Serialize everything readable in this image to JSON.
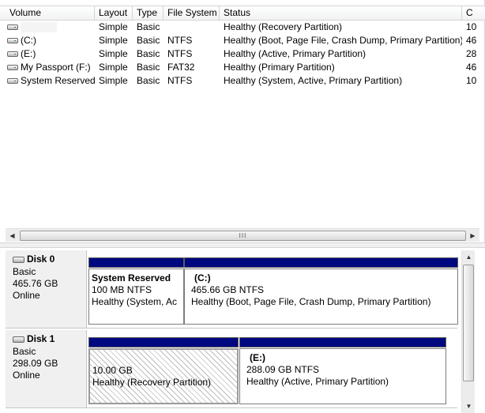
{
  "volume_list": {
    "columns": [
      {
        "key": "volume",
        "label": "Volume"
      },
      {
        "key": "layout",
        "label": "Layout"
      },
      {
        "key": "type",
        "label": "Type"
      },
      {
        "key": "fs",
        "label": "File System"
      },
      {
        "key": "status",
        "label": "Status"
      },
      {
        "key": "capacity",
        "label": "C"
      }
    ],
    "rows": [
      {
        "volume": "",
        "layout": "Simple",
        "type": "Basic",
        "fs": "",
        "status": "Healthy (Recovery Partition)",
        "capacity": "10"
      },
      {
        "volume": "(C:)",
        "layout": "Simple",
        "type": "Basic",
        "fs": "NTFS",
        "status": "Healthy (Boot, Page File, Crash Dump, Primary Partition)",
        "capacity": "46"
      },
      {
        "volume": "(E:)",
        "layout": "Simple",
        "type": "Basic",
        "fs": "NTFS",
        "status": "Healthy (Active, Primary Partition)",
        "capacity": "28"
      },
      {
        "volume": "My Passport (F:)",
        "layout": "Simple",
        "type": "Basic",
        "fs": "FAT32",
        "status": "Healthy (Primary Partition)",
        "capacity": "46"
      },
      {
        "volume": "System Reserved",
        "layout": "Simple",
        "type": "Basic",
        "fs": "NTFS",
        "status": "Healthy (System, Active, Primary Partition)",
        "capacity": "10"
      }
    ],
    "scroll_grip": "III",
    "arrow_left": "◀",
    "arrow_right": "▶"
  },
  "disks": [
    {
      "name": "Disk 0",
      "type": "Basic",
      "size": "465.76 GB",
      "status": "Online",
      "partitions": [
        {
          "title": "System Reserved",
          "size_fs": "100 MB NTFS",
          "status": "Healthy (System, Ac"
        },
        {
          "title": "(C:)",
          "size_fs": "465.66 GB NTFS",
          "status": "Healthy (Boot, Page File, Crash Dump, Primary Partition)"
        }
      ]
    },
    {
      "name": "Disk 1",
      "type": "Basic",
      "size": "298.09 GB",
      "status": "Online",
      "partitions": [
        {
          "title": "",
          "size_fs": "10.00 GB",
          "status": "Healthy (Recovery Partition)"
        },
        {
          "title": "(E:)",
          "size_fs": "288.09 GB NTFS",
          "status": "Healthy (Active, Primary Partition)"
        }
      ]
    }
  ],
  "disk_scroll": {
    "arrow_up": "▲",
    "arrow_down": "▼"
  },
  "colors": {
    "partition_bar": "#00087f",
    "pane_label_bg": "#f0f0f0"
  }
}
